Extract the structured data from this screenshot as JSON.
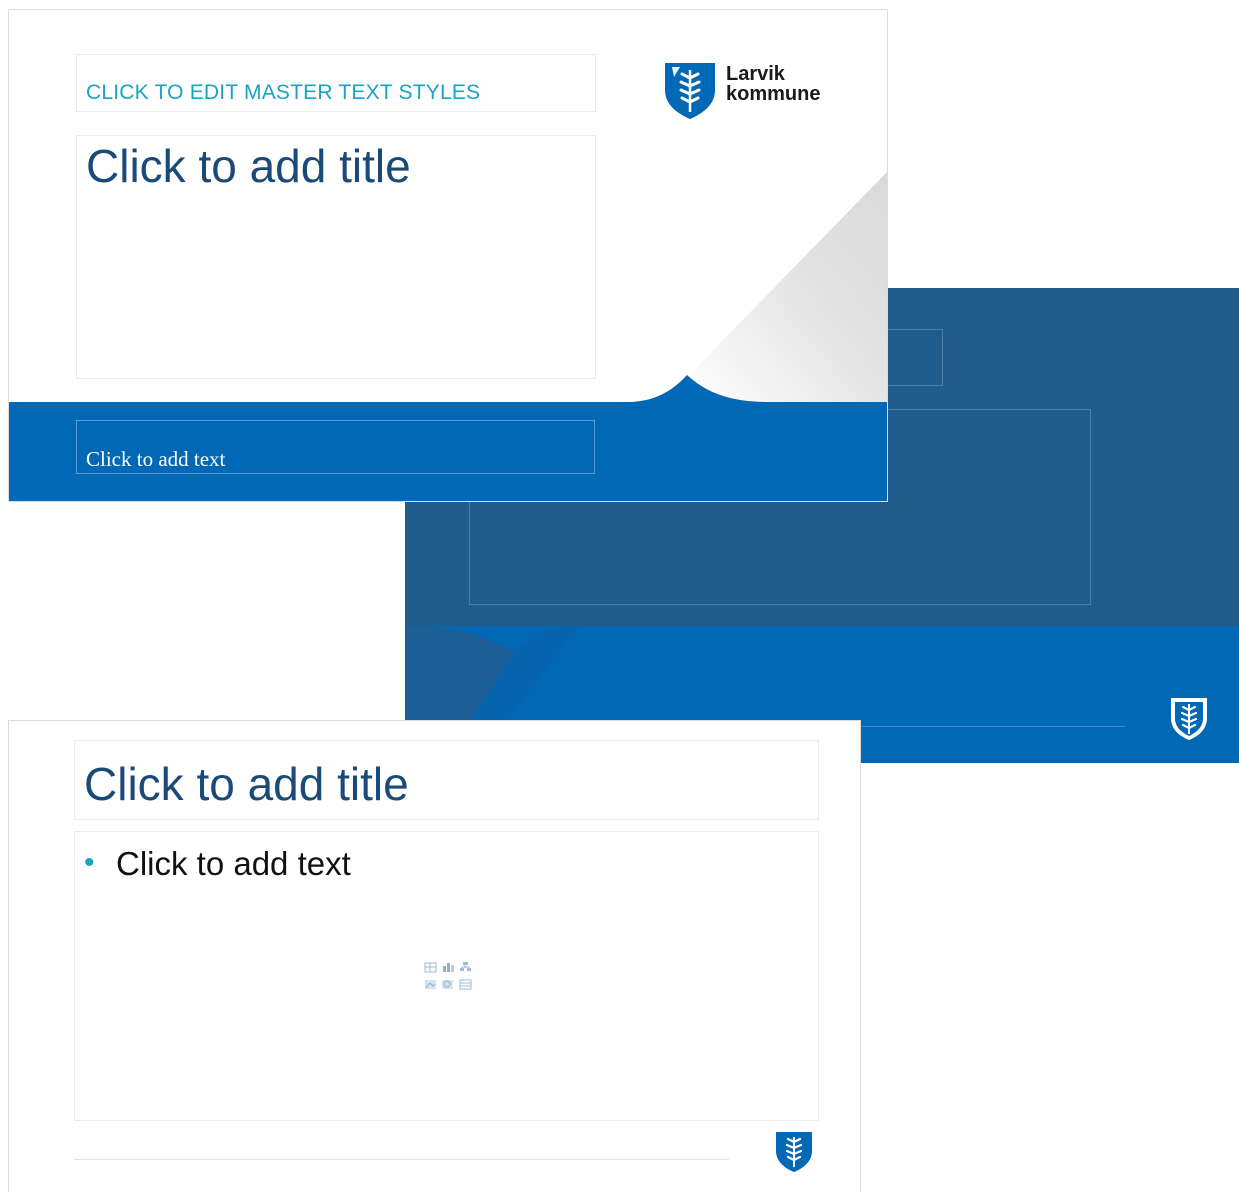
{
  "colors": {
    "dark_blue": "#1f5c8b",
    "bright_blue": "#0068b4",
    "title_navy": "#1b4a78",
    "teal": "#1aa3c6"
  },
  "slides": {
    "title_slide": {
      "subtitle": "CLICK TO EDIT MASTER TEXT STYLES",
      "title": "Click to add title",
      "text": "Click to add text",
      "logo": {
        "icon": "larvik-shield-logo-icon",
        "word_1": "Larvik",
        "word_2": "kommune"
      }
    },
    "section_slide": {
      "icon": "larvik-shield-icon"
    },
    "content_slide": {
      "title": "Click to add title",
      "bullet": "•",
      "text": "Click to add text",
      "insert_icons": [
        "table-icon",
        "chart-icon",
        "smartart-icon",
        "picture-icon",
        "online-picture-icon",
        "video-icon"
      ],
      "icon": "larvik-shield-icon"
    }
  }
}
